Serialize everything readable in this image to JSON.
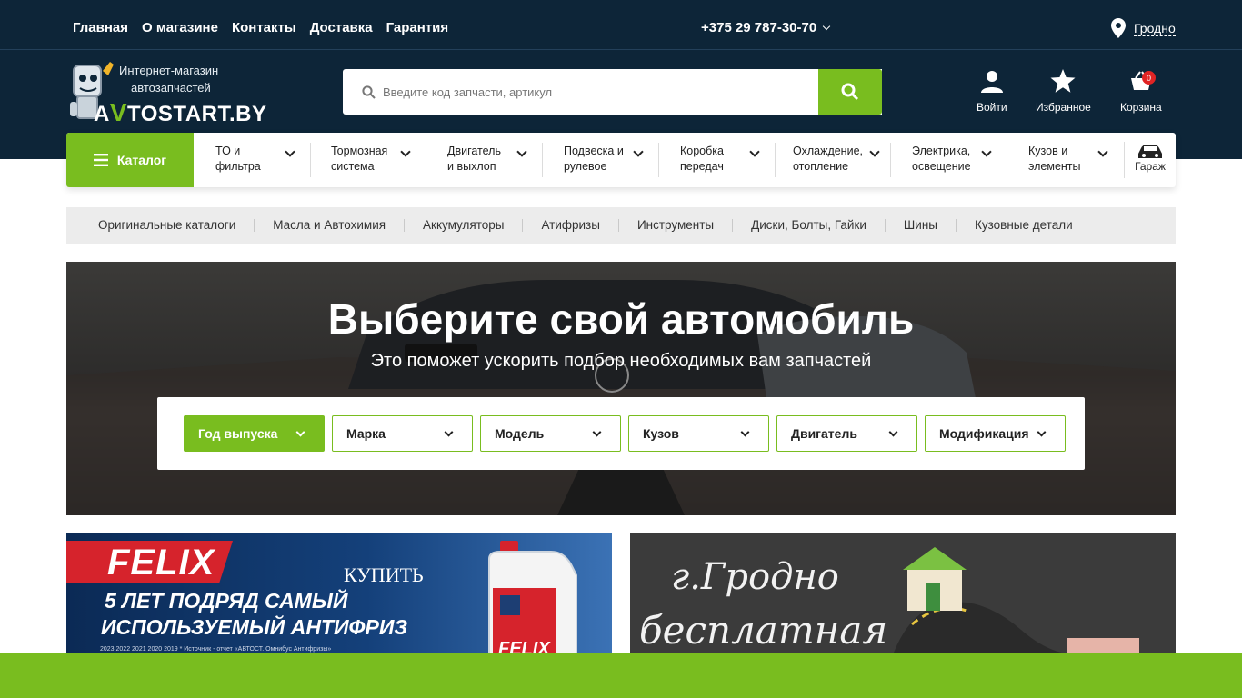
{
  "topnav": {
    "links": [
      "Главная",
      "О магазине",
      "Контакты",
      "Доставка",
      "Гарантия"
    ],
    "phone": "+375 29 787-30-70",
    "city": "Гродно"
  },
  "logo": {
    "line1": "Интернет-магазин",
    "line2": "автозапчастей",
    "brand_prefix": "A",
    "brand_v": "V",
    "brand_rest": "TOSTART.BY"
  },
  "search": {
    "placeholder": "Введите код запчасти, артикул",
    "value": ""
  },
  "actions": {
    "login": "Войти",
    "favorites": "Избранное",
    "cart": "Корзина",
    "cart_count": "0"
  },
  "catalog": {
    "button": "Каталог",
    "items": [
      "ТО и\nфильтра",
      "Тормозная\nсистема",
      "Двигатель\nи выхлоп",
      "Подвеска и\nрулевое",
      "Коробка\nпередач",
      "Охлаждение,\nотопление",
      "Электрика,\nосвещение",
      "Кузов и\nэлементы"
    ],
    "garage": "Гараж"
  },
  "subnav": [
    "Оригинальные каталоги",
    "Масла и Автохимия",
    "Аккумуляторы",
    "Атифризы",
    "Инструменты",
    "Диски, Болты, Гайки",
    "Шины",
    "Кузовные детали"
  ],
  "hero": {
    "title": "Выберите свой автомобиль",
    "subtitle": "Это поможет ускорить подбор необходимых вам запчастей",
    "selects": [
      "Год выпуска",
      "Марка",
      "Модель",
      "Кузов",
      "Двигатель",
      "Модификация"
    ]
  },
  "banner1": {
    "logo": "FELIX",
    "buy": "КУПИТЬ",
    "line1": "5 ЛЕТ ПОДРЯД САМЫЙ",
    "line2": "ИСПОЛЬЗУЕМЫЙ АНТИФРИЗ",
    "years": "2023      2022      2021      2020      2019        * Источник - отчет «АВТОСТ. Омнибус Антифризы»"
  },
  "banner2": {
    "line1": "г.Гродно",
    "line2": "бесплатная"
  },
  "colors": {
    "header_bg": "#0d2538",
    "accent": "#79bd1f",
    "badge": "#e02424"
  }
}
